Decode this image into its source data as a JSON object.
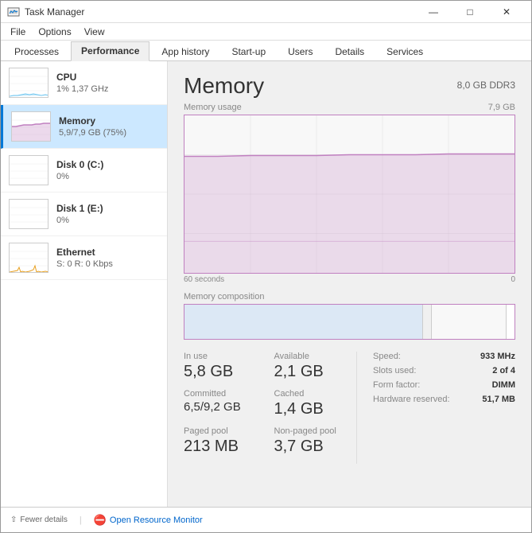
{
  "window": {
    "title": "Task Manager",
    "controls": {
      "minimize": "—",
      "maximize": "□",
      "close": "✕"
    }
  },
  "menu": {
    "items": [
      "File",
      "Options",
      "View"
    ]
  },
  "tabs": [
    {
      "id": "processes",
      "label": "Processes"
    },
    {
      "id": "performance",
      "label": "Performance"
    },
    {
      "id": "app-history",
      "label": "App history"
    },
    {
      "id": "startup",
      "label": "Start-up"
    },
    {
      "id": "users",
      "label": "Users"
    },
    {
      "id": "details",
      "label": "Details"
    },
    {
      "id": "services",
      "label": "Services"
    }
  ],
  "sidebar": {
    "items": [
      {
        "id": "cpu",
        "name": "CPU",
        "value": "1% 1,37 GHz",
        "graph_color": "#6bc5f0"
      },
      {
        "id": "memory",
        "name": "Memory",
        "value": "5,9/7,9 GB (75%)",
        "active": true,
        "graph_color": "#c080c0"
      },
      {
        "id": "disk0",
        "name": "Disk 0 (C:)",
        "value": "0%",
        "graph_color": "#7cb87c"
      },
      {
        "id": "disk1",
        "name": "Disk 1 (E:)",
        "value": "0%",
        "graph_color": "#7cb87c"
      },
      {
        "id": "ethernet",
        "name": "Ethernet",
        "value": "S: 0 R: 0 Kbps",
        "graph_color": "#e8a020"
      }
    ]
  },
  "main": {
    "title": "Memory",
    "subtitle": "8,0 GB DDR3",
    "graph": {
      "label": "Memory usage",
      "max_label": "7,9 GB",
      "time_start": "60 seconds",
      "time_end": "0",
      "composition_label": "Memory composition"
    },
    "stats_left": [
      {
        "label": "In use",
        "value": "5,8 GB"
      },
      {
        "label": "Committed",
        "value": "6,5/9,2 GB",
        "small": true
      },
      {
        "label": "Paged pool",
        "value": "213 MB"
      }
    ],
    "stats_left2": [
      {
        "label": "Available",
        "value": "2,1 GB"
      },
      {
        "label": "Cached",
        "value": "1,4 GB"
      },
      {
        "label": "Non-paged pool",
        "value": "3,7 GB"
      }
    ],
    "stats_right": [
      {
        "label": "Speed:",
        "value": "933 MHz"
      },
      {
        "label": "Slots used:",
        "value": "2 of 4"
      },
      {
        "label": "Form factor:",
        "value": "DIMM"
      },
      {
        "label": "Hardware reserved:",
        "value": "51,7 MB"
      }
    ]
  },
  "bottom": {
    "fewer_details": "Fewer details",
    "open_monitor": "Open Resource Monitor",
    "separator": "|"
  }
}
